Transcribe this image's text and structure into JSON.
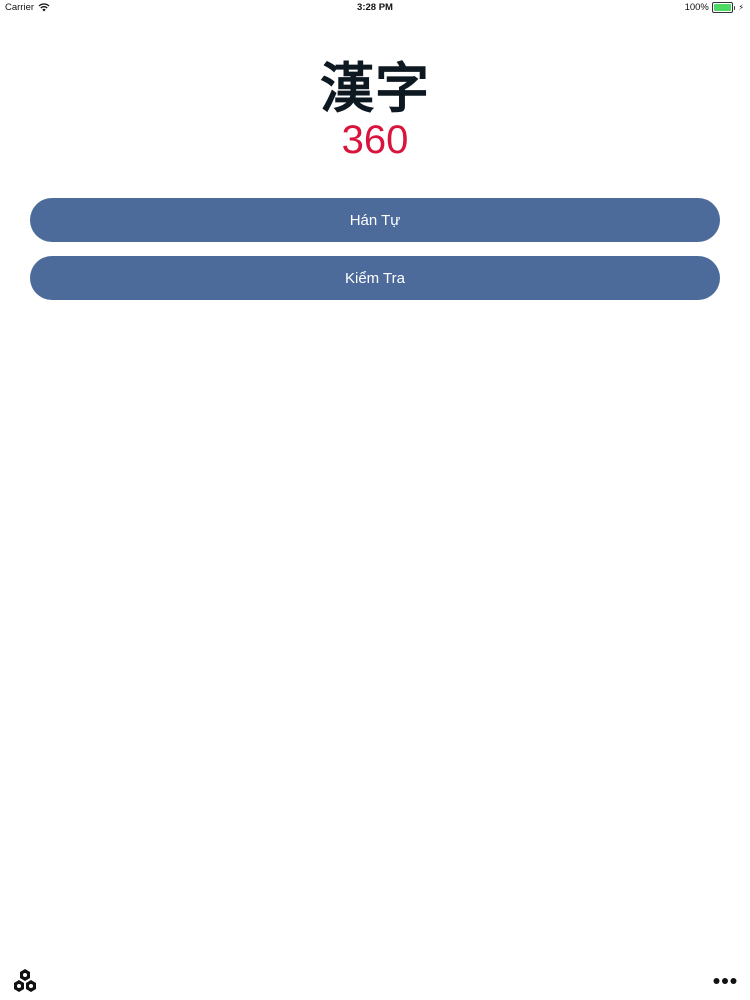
{
  "status_bar": {
    "carrier": "Carrier",
    "time": "3:28 PM",
    "battery": "100%",
    "battery_level": 1.0
  },
  "logo": {
    "kanji": "漢字",
    "number": "360"
  },
  "menu": {
    "han_tu_label": "Hán Tự",
    "kiem_tra_label": "Kiểm Tra"
  },
  "toolbar": {
    "left_icon": "hexagon-cluster-icon",
    "right_icon": "more-icon"
  },
  "colors": {
    "button_bg": "#4c6b9b",
    "logo_kanji": "#0d1820",
    "logo_number": "#d9143c",
    "battery_fill": "#4cd964"
  }
}
